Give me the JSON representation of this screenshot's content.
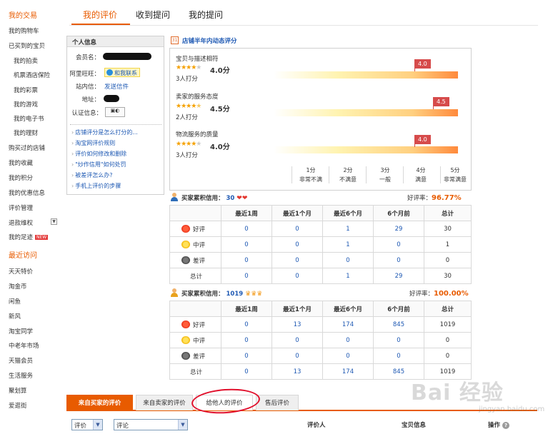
{
  "sidebar": {
    "my_trade": "我的交易",
    "cart": "我的购物车",
    "bought_heading": "已买到的宝贝",
    "sub_items": [
      "我的拍卖",
      "机票酒店保险",
      "我的彩票",
      "我的游戏",
      "我的电子书",
      "我的理财"
    ],
    "items_a": [
      "购买过的店铺",
      "我的收藏",
      "我的积分",
      "我的优惠信息",
      "评价管理",
      "退款维权"
    ],
    "footprint": "我的足迹",
    "new_badge": "NEW",
    "recent_heading": "最近访问",
    "recent_items": [
      "天天特价",
      "淘金币",
      "闲鱼",
      "新风",
      "淘宝同学",
      "中老年市场",
      "天猫会员",
      "生活服务",
      "聚划算",
      "爱逛街"
    ]
  },
  "top_tabs": [
    "我的评价",
    "收到提问",
    "我的提问"
  ],
  "info": {
    "title": "个人信息",
    "labels": [
      "会员名：",
      "阿里旺旺：",
      "站内信：",
      "地址：",
      "认证信息："
    ],
    "contact_btn": "和我联系",
    "send_msg": "发送信件",
    "links": [
      "店铺评分是怎么打分的...",
      "淘宝网评价规则",
      "评价如何修改和删除",
      "\"炒作信用\"如何处罚",
      "被差评怎么办?",
      "手机上评价的步骤"
    ]
  },
  "rating": {
    "header": "店铺半年内动态评分",
    "items": [
      {
        "title": "宝贝与描述相符",
        "score": "4.0分",
        "count": "3人打分",
        "flag": "4.0",
        "stars": 4
      },
      {
        "title": "卖家的服务态度",
        "score": "4.5分",
        "count": "2人打分",
        "flag": "4.5",
        "stars": 4.5
      },
      {
        "title": "物流服务的质量",
        "score": "4.0分",
        "count": "3人打分",
        "flag": "4.0",
        "stars": 4
      }
    ],
    "scale": [
      {
        "num": "1分",
        "desc": "非常不满"
      },
      {
        "num": "2分",
        "desc": "不满意"
      },
      {
        "num": "3分",
        "desc": "一般"
      },
      {
        "num": "4分",
        "desc": "满意"
      },
      {
        "num": "5分",
        "desc": "非常满意"
      }
    ]
  },
  "buyer_credit": {
    "label": "买家累积信用：",
    "score": "30",
    "good_rate_label": "好评率：",
    "good_rate": "96.77%",
    "headers": [
      "",
      "最近1周",
      "最近1个月",
      "最近6个月",
      "6个月前",
      "总计"
    ],
    "rows": [
      {
        "label": "好评",
        "values": [
          "0",
          "0",
          "1",
          "29",
          "30"
        ]
      },
      {
        "label": "中评",
        "values": [
          "0",
          "0",
          "1",
          "0",
          "1"
        ]
      },
      {
        "label": "差评",
        "values": [
          "0",
          "0",
          "0",
          "0",
          "0"
        ]
      },
      {
        "label": "总计",
        "values": [
          "0",
          "0",
          "1",
          "29",
          "30"
        ]
      }
    ]
  },
  "seller_credit": {
    "label": "买家累积信用：",
    "score": "1019",
    "good_rate_label": "好评率：",
    "good_rate": "100.00%",
    "headers": [
      "",
      "最近1周",
      "最近1个月",
      "最近6个月",
      "6个月前",
      "总计"
    ],
    "rows": [
      {
        "label": "好评",
        "values": [
          "0",
          "13",
          "174",
          "845",
          "1019"
        ]
      },
      {
        "label": "中评",
        "values": [
          "0",
          "0",
          "0",
          "0",
          "0"
        ]
      },
      {
        "label": "差评",
        "values": [
          "0",
          "0",
          "0",
          "0",
          "0"
        ]
      },
      {
        "label": "总计",
        "values": [
          "0",
          "13",
          "174",
          "845",
          "1019"
        ]
      }
    ]
  },
  "bottom_tabs": [
    "来自买家的评价",
    "来自卖家的评价",
    "给他人的评价",
    "售后评价"
  ],
  "filters": {
    "select1": "评价",
    "select2": "评论",
    "col_reviewer": "评价人",
    "col_item": "宝贝信息",
    "col_op": "操作"
  },
  "watermark": {
    "main": "Bai 经验",
    "sub": "jingyan.baidu.com"
  }
}
